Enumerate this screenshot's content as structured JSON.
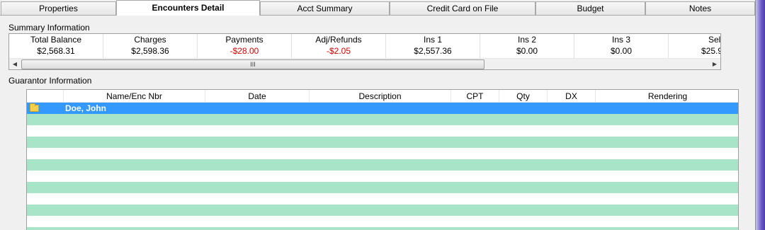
{
  "tabs": [
    {
      "label": "Properties"
    },
    {
      "label": "Encounters Detail"
    },
    {
      "label": "Acct Summary"
    },
    {
      "label": "Credit Card on File"
    },
    {
      "label": "Budget"
    },
    {
      "label": "Notes"
    }
  ],
  "active_tab": "Encounters Detail",
  "summary": {
    "label": "Summary Information",
    "columns": [
      {
        "header": "Total Balance",
        "value": "$2,568.31"
      },
      {
        "header": "Charges",
        "value": "$2,598.36"
      },
      {
        "header": "Payments",
        "value": "-$28.00"
      },
      {
        "header": "Adj/Refunds",
        "value": "-$2.05"
      },
      {
        "header": "Ins 1",
        "value": "$2,557.36"
      },
      {
        "header": "Ins 2",
        "value": "$0.00"
      },
      {
        "header": "Ins 3",
        "value": "$0.00"
      },
      {
        "header": "Sel",
        "value": "$25.9"
      }
    ],
    "negative_color": "#e00000",
    "scroll_thumb_grip": "III"
  },
  "guarantor": {
    "label": "Guarantor Information",
    "columns": [
      "Name/Enc Nbr",
      "Date",
      "Description",
      "CPT",
      "Qty",
      "DX",
      "Rendering"
    ],
    "rows": [
      {
        "name": "Doe, John",
        "selected": true,
        "icon": "folder-icon"
      }
    ],
    "colors": {
      "selected": "#3399ff",
      "alt_row": "#a8e4c8"
    }
  }
}
